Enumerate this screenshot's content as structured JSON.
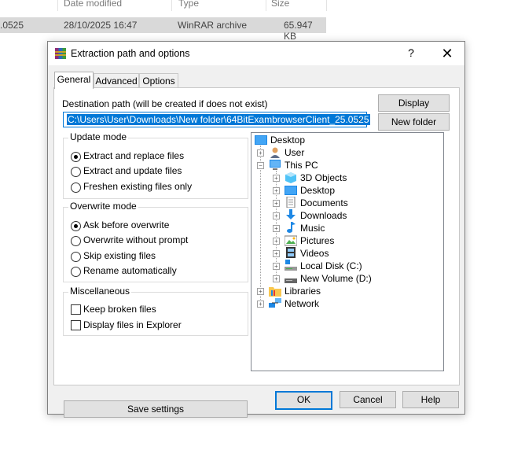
{
  "explorer": {
    "columns": {
      "date": "Date modified",
      "type": "Type",
      "size": "Size"
    },
    "row": {
      "name": ".0525",
      "date": "28/10/2025 16:47",
      "type": "WinRAR archive",
      "size": "65.947 KB"
    }
  },
  "dialog": {
    "title": "Extraction path and options",
    "help_label": "?",
    "close_label": "✕",
    "tabs": [
      {
        "label": "General",
        "active": true
      },
      {
        "label": "Advanced",
        "active": false
      },
      {
        "label": "Options",
        "active": false
      }
    ],
    "destination": {
      "label": "Destination path (will be created if does not exist)",
      "value": "C:\\Users\\User\\Downloads\\New folder\\64BitExambrowserClient_25.0525"
    },
    "buttons": {
      "display": "Display",
      "new_folder": "New folder",
      "save_settings": "Save settings"
    },
    "update_mode": {
      "title": "Update mode",
      "options": [
        "Extract and replace files",
        "Extract and update files",
        "Freshen existing files only"
      ],
      "selected": 0
    },
    "overwrite_mode": {
      "title": "Overwrite mode",
      "options": [
        "Ask before overwrite",
        "Overwrite without prompt",
        "Skip existing files",
        "Rename automatically"
      ],
      "selected": 0
    },
    "misc": {
      "title": "Miscellaneous",
      "options": [
        "Keep broken files",
        "Display files in Explorer"
      ]
    },
    "tree": {
      "desktop": "Desktop",
      "user": "User",
      "this_pc": "This PC",
      "children": [
        "3D Objects",
        "Desktop",
        "Documents",
        "Downloads",
        "Music",
        "Pictures",
        "Videos",
        "Local Disk (C:)",
        "New Volume (D:)"
      ],
      "libraries": "Libraries",
      "network": "Network"
    },
    "footer": {
      "ok": "OK",
      "cancel": "Cancel",
      "help": "Help"
    }
  }
}
